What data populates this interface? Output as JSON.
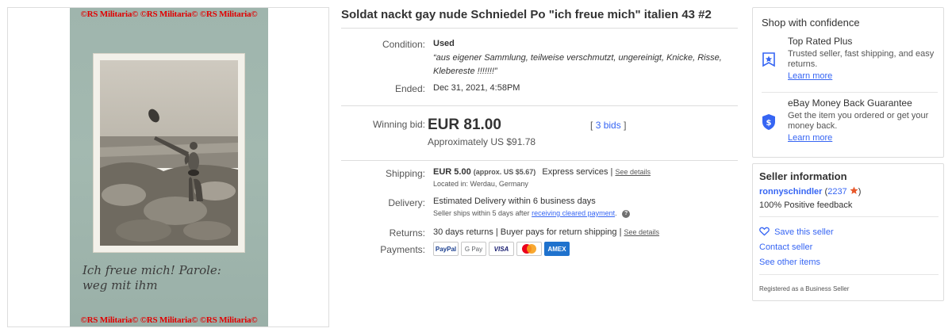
{
  "image": {
    "watermark_top": "©RS Militaria© ©RS Militaria© ©RS Militaria©",
    "watermark_bottom": "©RS Militaria© ©RS Militaria© ©RS Militaria©",
    "handwriting_line1": "Ich freue mich! Parole:",
    "handwriting_line2": "weg mit ihm"
  },
  "listing": {
    "title": "Soldat nackt gay nude Schniedel Po \"ich freue mich\" italien 43 #2",
    "condition_label": "Condition:",
    "condition_value": "Used",
    "condition_description": "“aus eigener Sammlung, teilweise verschmutzt, ungereinigt, Knicke, Risse, Klebereste !!!!!!!”",
    "ended_label": "Ended:",
    "ended_value": "Dec 31, 2021, 4:58PM",
    "winning_bid_label": "Winning bid:",
    "winning_bid_value": "EUR 81.00",
    "approx_value": "Approximately US $91.78",
    "bids_open": "[",
    "bids_link": "3 bids",
    "bids_close": "]",
    "shipping_label": "Shipping:",
    "shipping_value": "EUR 5.00",
    "shipping_approx": "(approx. US $5.67)",
    "shipping_service": "Express services |",
    "shipping_details_link": "See details",
    "located_in": "Located in: Werdau, Germany",
    "delivery_label": "Delivery:",
    "delivery_value": "Estimated Delivery within 6 business days",
    "delivery_note": "Seller ships within 5 days after",
    "delivery_note_link": "receiving cleared payment",
    "delivery_note_end": ".",
    "returns_label": "Returns:",
    "returns_value": "30 days returns | Buyer pays for return shipping |",
    "returns_details_link": "See details",
    "payments_label": "Payments:",
    "payment_methods": [
      "PayPal",
      "G Pay",
      "VISA",
      "Mastercard",
      "AMEX"
    ]
  },
  "shop_confidence": {
    "title": "Shop with confidence",
    "top_rated_title": "Top Rated Plus",
    "top_rated_desc": "Trusted seller, fast shipping, and easy returns.",
    "top_rated_link": "Learn more",
    "guarantee_title": "eBay Money Back Guarantee",
    "guarantee_desc": "Get the item you ordered or get your money back.",
    "guarantee_link": "Learn more"
  },
  "seller": {
    "title": "Seller information",
    "name": "ronnyschindler",
    "score_open": "(",
    "score": "2237",
    "score_close": ")",
    "feedback": "100% Positive feedback",
    "save_seller": "Save this seller",
    "contact_seller": "Contact seller",
    "other_items": "See other items",
    "registered": "Registered as a Business Seller"
  },
  "colors": {
    "link": "#3665f3",
    "star": "#e8582b",
    "shield": "#3665f3"
  }
}
